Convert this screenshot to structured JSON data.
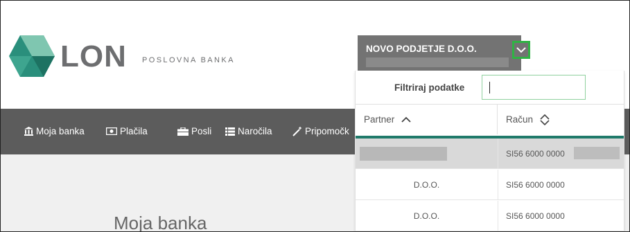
{
  "brand": {
    "name": "LON",
    "subtitle": "POSLOVNA BANKA",
    "colors": {
      "hex_dark": "#2a8f7c",
      "hex_light": "#7fc6b0",
      "text": "#6d6e70"
    }
  },
  "company": {
    "name": "NOVO PODJETJE D.O.O.",
    "toggle_icon": "chevron-down-icon",
    "accent": "#2fb344"
  },
  "nav": {
    "items": [
      {
        "label": "Moja banka",
        "icon": "bank-icon"
      },
      {
        "label": "Plačila",
        "icon": "banknote-icon"
      },
      {
        "label": "Posli",
        "icon": "briefcase-icon"
      },
      {
        "label": "Naročila",
        "icon": "list-icon"
      },
      {
        "label": "Pripomočk",
        "icon": "magic-wand-icon"
      }
    ]
  },
  "main": {
    "title": "Moja banka"
  },
  "dropdown": {
    "filter_label": "Filtriraj podatke",
    "filter_value": "",
    "columns": [
      {
        "label": "Partner",
        "sort": "ascending",
        "icon": "chevron-up-icon"
      },
      {
        "label": "Račun",
        "sort": "none",
        "icon": "sort-icon"
      }
    ],
    "rows": [
      {
        "partner": "",
        "account": "SI56 6000 0000",
        "selected": true
      },
      {
        "partner": "D.O.O.",
        "account": "SI56 6000 0000",
        "selected": false
      },
      {
        "partner": "D.O.O.",
        "account": "SI56 6000 0000",
        "selected": false
      }
    ],
    "header_accent": "#1f7a6a"
  }
}
